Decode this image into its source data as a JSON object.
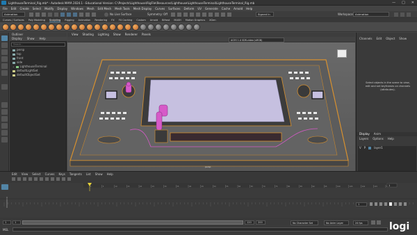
{
  "window": {
    "title": "LighthouseTerminal_Rig.mb* - Autodesk MAYA 2024.1 - Educational Version: C:\\Projects\\Lighthouse\\RigFile\\Resources\\Lighthouse\\LighthouseTerminal\\LighthouseTerminal_Rig.mb",
    "controls": [
      "—",
      "□",
      "✕"
    ]
  },
  "menubar": [
    "File",
    "Edit",
    "Create",
    "Select",
    "Modify",
    "Display",
    "Windows",
    "Mesh",
    "Edit Mesh",
    "Mesh Tools",
    "Mesh Display",
    "Curves",
    "Surfaces",
    "Deform",
    "UV",
    "Generate",
    "Cache",
    "Arnold",
    "Help"
  ],
  "status": {
    "menuset": "Animation",
    "no_live_surface": "No Live Surface",
    "symmetry": "Symmetry: Off",
    "user": "Signed In",
    "workspace_label": "Workspace:",
    "workspace": "Animation"
  },
  "shelf_tabs": [
    "Curves / Surfaces",
    "Poly Modeling",
    "Sculpting",
    "Rigging",
    "Animation",
    "Rendering",
    "FX",
    "FX Caching",
    "Custom",
    "Arnold",
    "Bifrost",
    "MASH",
    "Motion Graphics",
    "XGen"
  ],
  "outliner": {
    "title": "Outliner",
    "menu": [
      "Display",
      "Show",
      "Help"
    ],
    "search_placeholder": "Search...",
    "items": [
      "persp",
      "top",
      "front",
      "side",
      "LighthouseTerminal",
      "defaultLightSet",
      "defaultObjectSet"
    ]
  },
  "viewport": {
    "menu": [
      "View",
      "Shading",
      "Lighting",
      "Show",
      "Renderer",
      "Panels"
    ],
    "camera_label": "persp",
    "color_space": "ACES 1.0 SDR-video (sRGB)"
  },
  "channel_box": {
    "menu": [
      "Channels",
      "Edit",
      "Object",
      "Show"
    ],
    "empty_message": "Select objects in the scene to view, edit and set keyframes on channels (attributes)."
  },
  "display_layers": {
    "tabs": [
      "Display",
      "Anim"
    ],
    "menu": [
      "Layers",
      "Options",
      "Help"
    ],
    "layer_v": "V",
    "layer_p": "P",
    "layer_name": "layer1"
  },
  "graph_editor": {
    "menu": [
      "Edit",
      "View",
      "Select",
      "Curves",
      "Keys",
      "Tangents",
      "List",
      "Show",
      "Help"
    ],
    "ticks": [
      "1",
      "5",
      "10",
      "15",
      "20",
      "25",
      "30",
      "35",
      "40",
      "45",
      "50",
      "55",
      "60",
      "65",
      "70",
      "75",
      "80",
      "85",
      "90",
      "95",
      "100",
      "105",
      "110",
      "115",
      "120"
    ],
    "current_frame": "1",
    "range_start": "1",
    "range_end": "120",
    "anim_start": "1",
    "anim_end": "200",
    "no_character_set": "No Character Set",
    "no_anim_layer": "No Anim Layer",
    "fps": "24 fps"
  },
  "commandline": {
    "language": "MEL"
  },
  "watermark": "logi",
  "colors": {
    "accent": "#5285a6",
    "playhead": "#e6d23a",
    "keyframe": "#b8362e",
    "shelf_icon": "#d9873c"
  }
}
